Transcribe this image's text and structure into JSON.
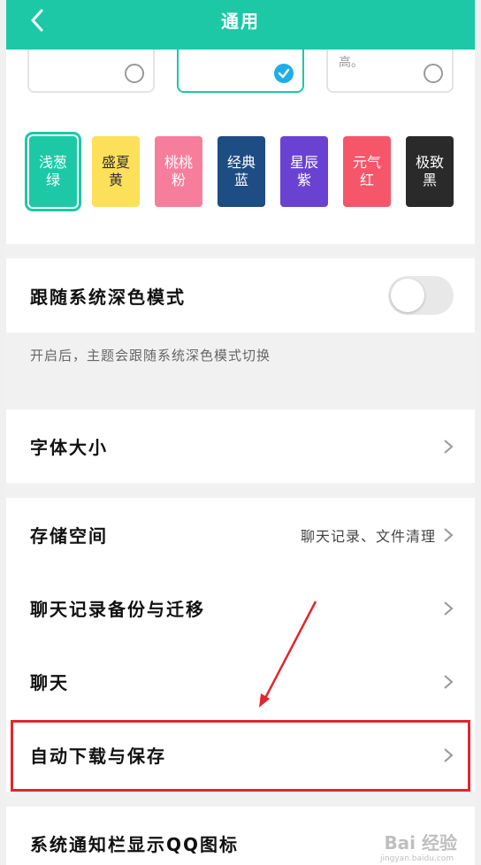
{
  "header": {
    "title": "通用",
    "back_icon": "chevron-left-icon",
    "color": "#1dc8a6"
  },
  "theme_cards": {
    "right_card_text": "高。"
  },
  "swatches": [
    {
      "label": "浅葱绿",
      "color": "#1dc8a6",
      "selected": true
    },
    {
      "label": "盛夏黄",
      "color": "#fde05a",
      "selected": false
    },
    {
      "label": "桃桃粉",
      "color": "#f67e9c",
      "selected": false
    },
    {
      "label": "经典蓝",
      "color": "#1d4d83",
      "selected": false
    },
    {
      "label": "星辰紫",
      "color": "#6a42d2",
      "selected": false
    },
    {
      "label": "元气红",
      "color": "#f5566a",
      "selected": false
    },
    {
      "label": "极致黑",
      "color": "#2a2a2a",
      "selected": false
    }
  ],
  "dark_mode": {
    "label": "跟随系统深色模式",
    "enabled": false,
    "note": "开启后，主题会跟随系统深色模式切换"
  },
  "font_size": {
    "label": "字体大小"
  },
  "storage": {
    "label": "存储空间",
    "value": "聊天记录、文件清理"
  },
  "backup": {
    "label": "聊天记录备份与迁移"
  },
  "chat": {
    "label": "聊天"
  },
  "auto_download": {
    "label": "自动下载与保存"
  },
  "notify_icon": {
    "label": "系统通知栏显示QQ图标"
  },
  "watermark": {
    "text": "Bai 经验",
    "sub": "jingyan.baidu.com"
  },
  "annotation_color": "#e0262e"
}
